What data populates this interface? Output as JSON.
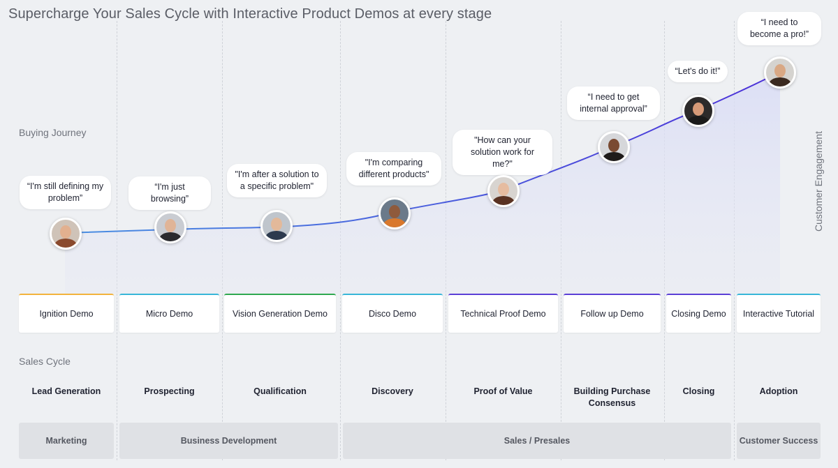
{
  "title": "Supercharge Your Sales Cycle with Interactive Product Demos at every stage",
  "labels": {
    "buying_journey": "Buying Journey",
    "sales_cycle": "Sales Cycle",
    "customer_engagement": "Customer Engagement"
  },
  "colors": {
    "line_start": "#4a90e2",
    "line_end": "#4b2fd8",
    "card_accents": [
      "#f2b33d",
      "#38b6d8",
      "#2fa84f",
      "#38b6d8",
      "#5b3fd6",
      "#5b3fd6",
      "#5b3fd6",
      "#38b6d8"
    ]
  },
  "journey": [
    {
      "quote": "“I'm still defining my problem”",
      "avatar": "woman-glasses-avatar"
    },
    {
      "quote": "“I'm just browsing”",
      "avatar": "woman-dark-hair-avatar"
    },
    {
      "quote": "\"I'm after a solution to a specific problem\"",
      "avatar": "man-suit-avatar"
    },
    {
      "quote": "\"I'm comparing different products\"",
      "avatar": "man-glasses-avatar"
    },
    {
      "quote": "\"How can your solution work for me?\"",
      "avatar": "woman-long-hair-avatar"
    },
    {
      "quote": "“I need to get internal approval”",
      "avatar": "woman-curly-hair-avatar"
    },
    {
      "quote": "“Let's do it!”",
      "avatar": "man-beard-avatar"
    },
    {
      "quote": "“I need to become a pro!”",
      "avatar": "man-long-hair-avatar"
    }
  ],
  "demos": [
    "Ignition Demo",
    "Micro Demo",
    "Vision Generation Demo",
    "Disco Demo",
    "Technical Proof Demo",
    "Follow up Demo",
    "Closing Demo",
    "Interactive Tutorial"
  ],
  "stages": [
    "Lead Generation",
    "Prospecting",
    "Qualification",
    "Discovery",
    "Proof of Value",
    "Building Purchase Consensus",
    "Closing",
    "Adoption"
  ],
  "departments": [
    "Marketing",
    "Business Development",
    "Sales / Presales",
    "Customer Success"
  ]
}
